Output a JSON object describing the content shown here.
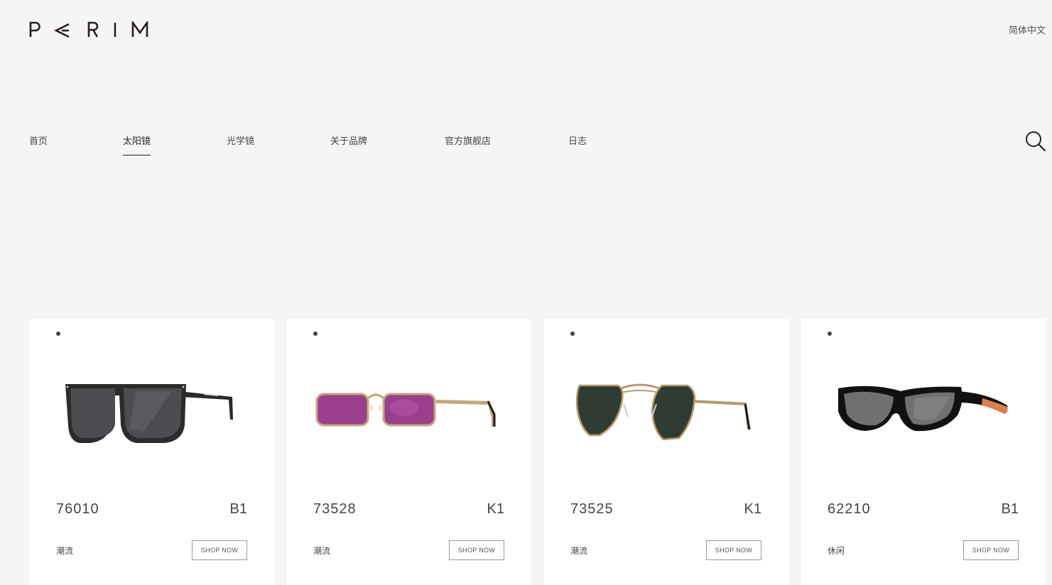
{
  "header": {
    "logo_text": "PARIM",
    "language": "简体中文"
  },
  "nav": {
    "items": [
      {
        "label": "首页",
        "active": false
      },
      {
        "label": "太阳镜",
        "active": true
      },
      {
        "label": "光学镜",
        "active": false
      },
      {
        "label": "关于品牌",
        "active": false
      },
      {
        "label": "官方旗舰店",
        "active": false
      },
      {
        "label": "日志",
        "active": false
      }
    ],
    "search_icon": "search-icon"
  },
  "products": [
    {
      "model": "76010",
      "color": "B1",
      "tag": "潮流",
      "shop_label": "SHOP NOW",
      "lens_color": "#4a4c50",
      "frame_color": "#2a2a2a",
      "style": "square"
    },
    {
      "model": "73528",
      "color": "K1",
      "tag": "潮流",
      "shop_label": "SHOP NOW",
      "lens_color": "#9a3f8e",
      "frame_color": "#c7a576",
      "style": "rect-metal"
    },
    {
      "model": "73525",
      "color": "K1",
      "tag": "潮流",
      "shop_label": "SHOP NOW",
      "lens_color": "#2f3c32",
      "frame_color": "#b8996a",
      "style": "aviator"
    },
    {
      "model": "62210",
      "color": "B1",
      "tag": "休闲",
      "shop_label": "SHOP NOW",
      "lens_color": "#6f7072",
      "frame_color": "#111111",
      "style": "sport"
    }
  ]
}
